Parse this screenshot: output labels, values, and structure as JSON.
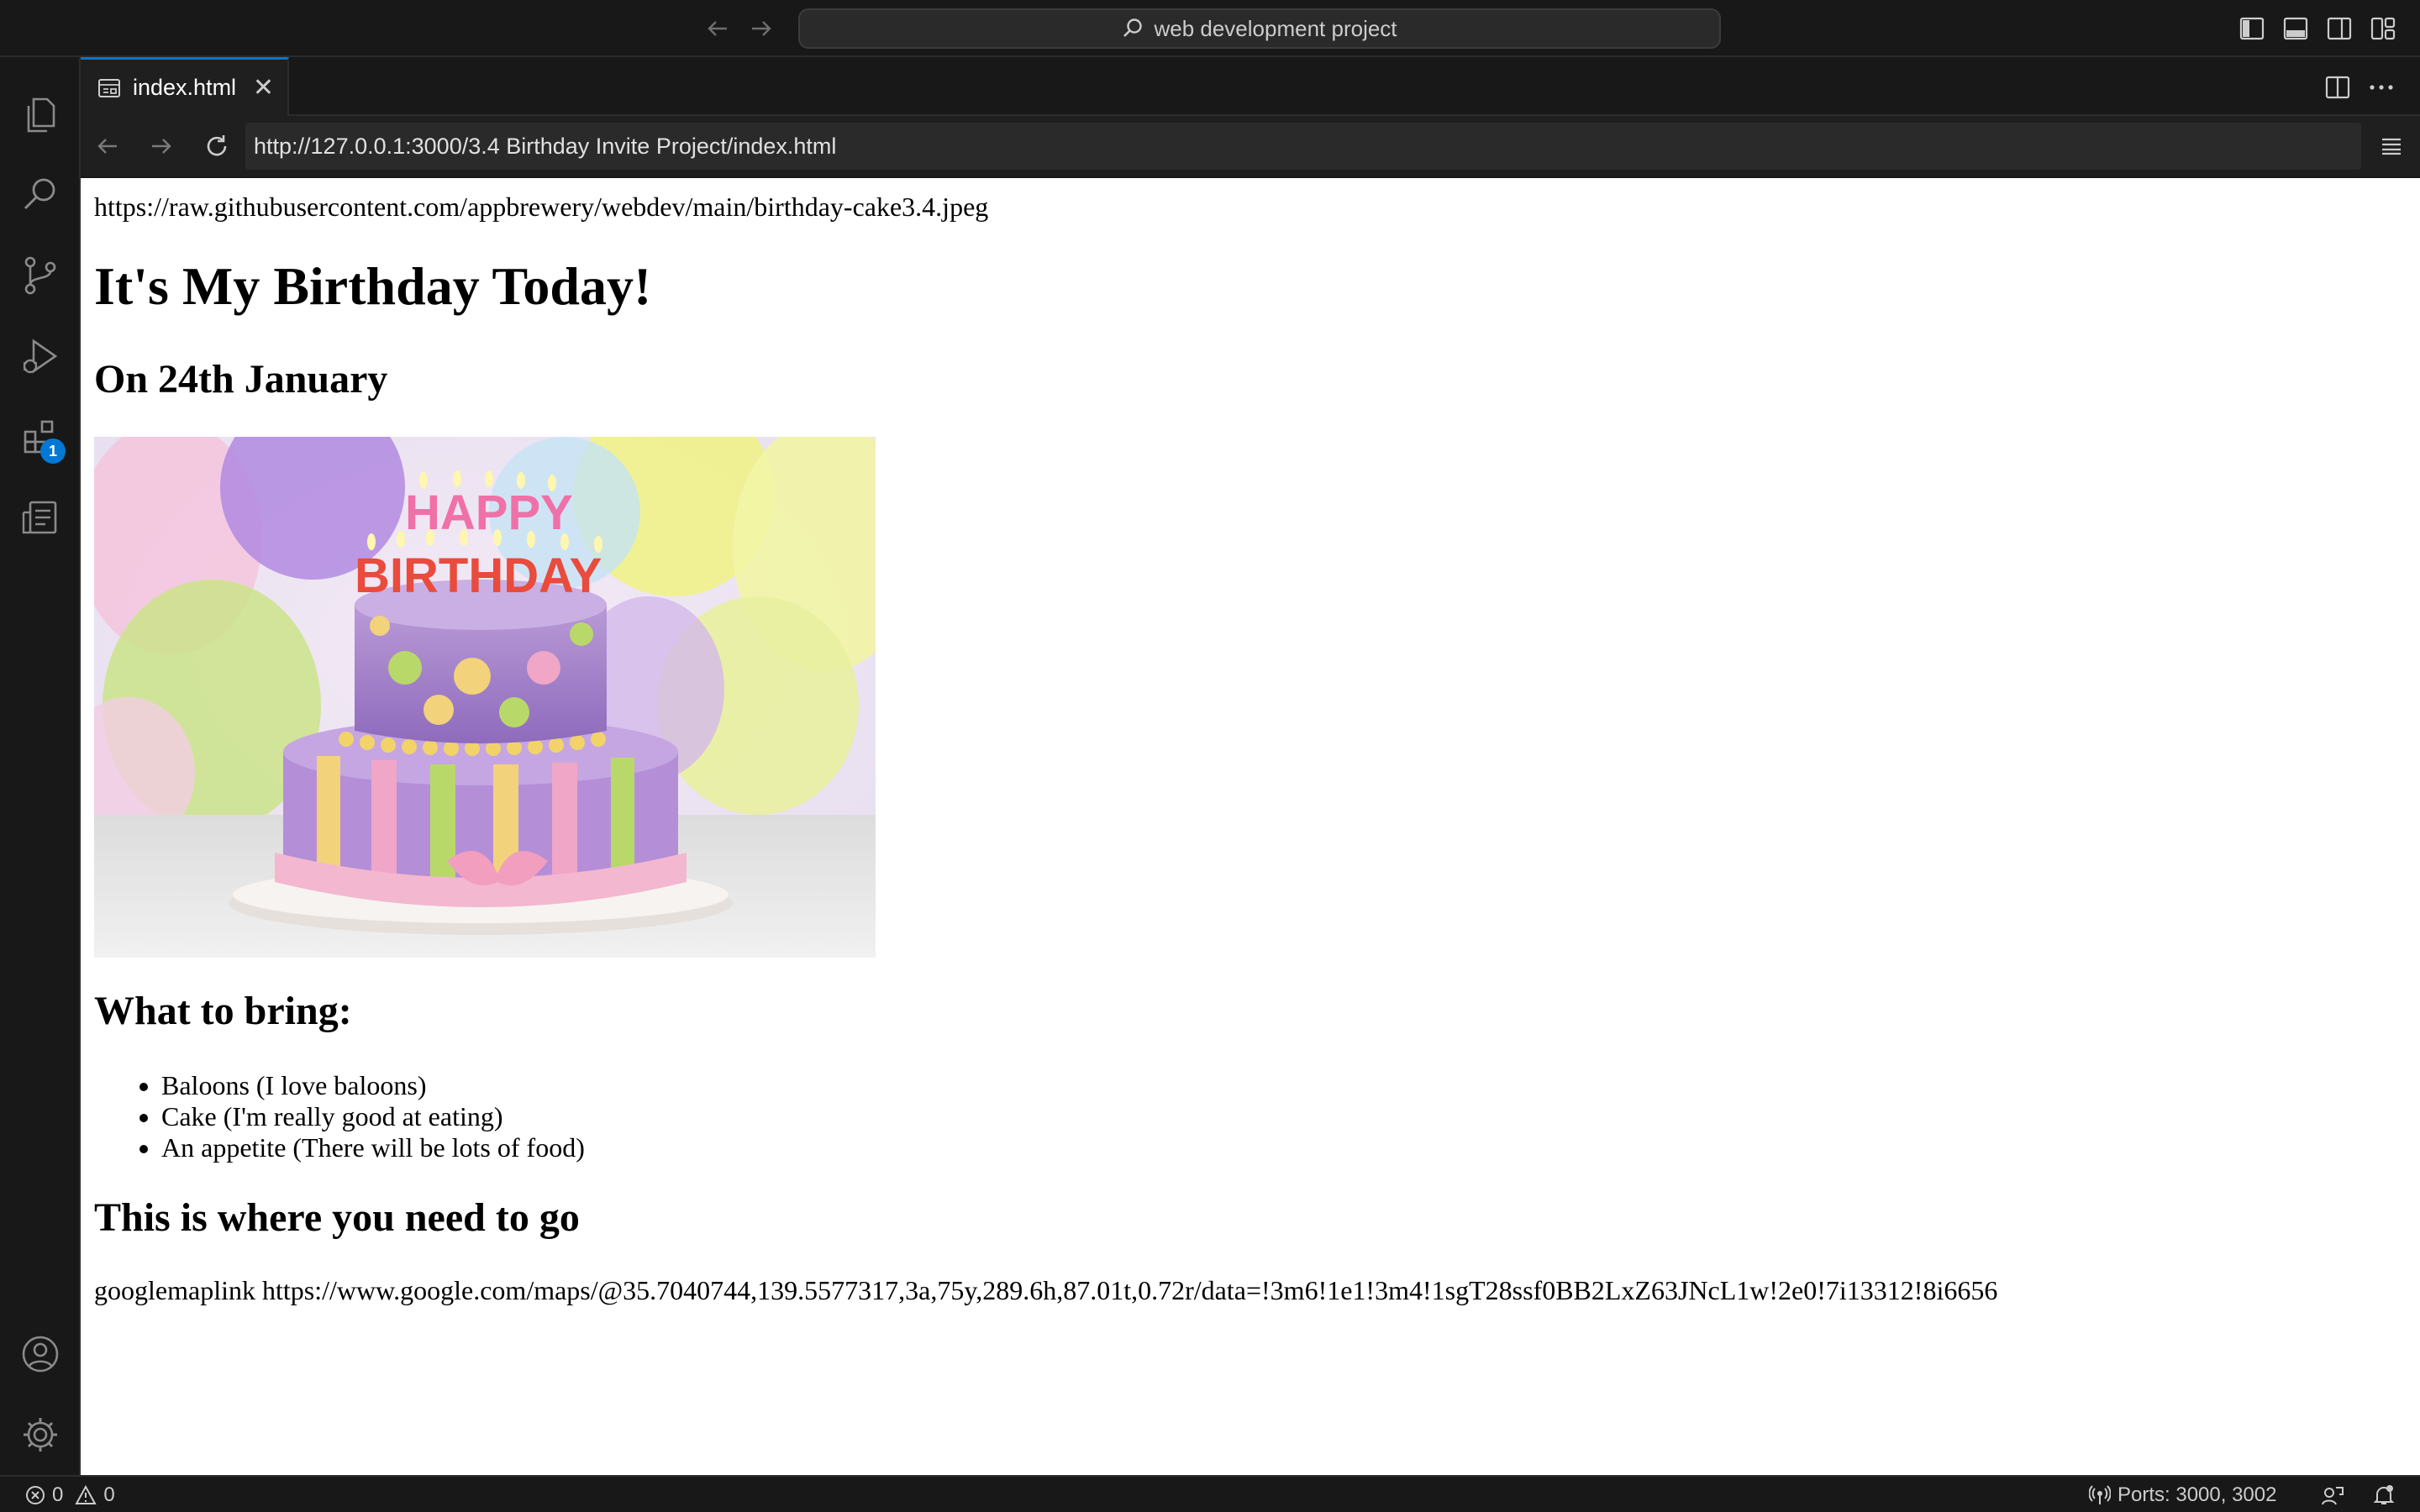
{
  "titlebar": {
    "search_text": "web development project"
  },
  "activity": {
    "extensions_badge": "1"
  },
  "editor": {
    "tab_label": "index.html"
  },
  "browser": {
    "url": "http://127.0.0.1:3000/3.4 Birthday Invite Project/index.html"
  },
  "page": {
    "image_url_text": "https://raw.githubusercontent.com/appbrewery/webdev/main/birthday-cake3.4.jpeg",
    "heading": "It's My Birthday Today!",
    "date_heading": "On 24th January",
    "bring_heading": "What to bring:",
    "bring_items": [
      "Baloons (I love baloons)",
      "Cake (I'm really good at eating)",
      "An appetite (There will be lots of food)"
    ],
    "location_heading": "This is where you need to go",
    "map_text": "googlemaplink https://www.google.com/maps/@35.7040744,139.5577317,3a,75y,289.6h,87.01t,0.72r/data=!3m6!1e1!3m4!1sgT28ssf0BB2LxZ63JNcL1w!2e0!7i13312!8i6656",
    "cake_letters_top": "HAPPY",
    "cake_letters_bottom": "BIRTHDAY"
  },
  "statusbar": {
    "errors": "0",
    "warnings": "0",
    "ports": "Ports: 3000, 3002"
  },
  "colors": {
    "accent": "#0078d4",
    "chrome_bg": "#181818",
    "editor_bg": "#1f1f1f"
  }
}
